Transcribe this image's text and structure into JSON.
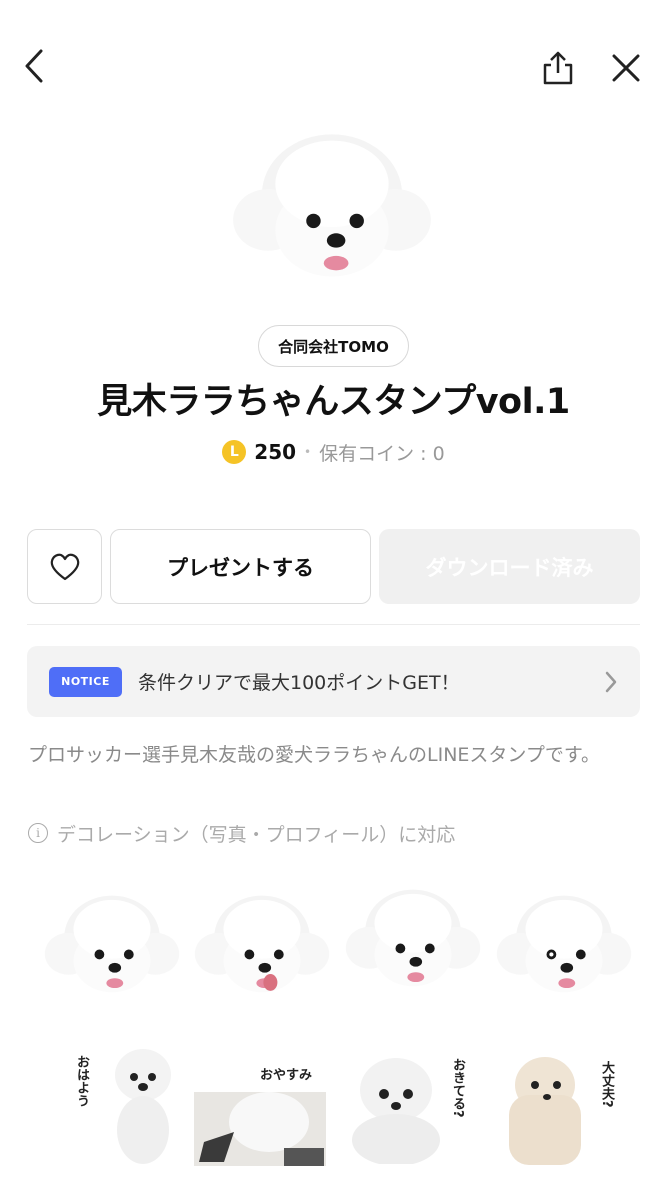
{
  "header": {
    "back_icon": "chevron-left-icon",
    "share_icon": "share-icon",
    "close_icon": "close-icon"
  },
  "product": {
    "author": "合同会社TOMO",
    "title": "見木ララちゃんスタンプvol.1",
    "coin_symbol": "L",
    "price": "250",
    "separator": "•",
    "owned_coins": "保有コイン : 0"
  },
  "actions": {
    "like_icon": "heart-icon",
    "gift_label": "プレゼントする",
    "download_label": "ダウンロード済み"
  },
  "notice": {
    "badge": "NOTICE",
    "text": "条件クリアで最大100ポイントGET！",
    "chevron_icon": "chevron-right-icon"
  },
  "description": "プロサッカー選手見木友哉の愛犬ララちゃんのLINEスタンプです。",
  "deco": {
    "info_icon": "i",
    "text": "デコレーション（写真・プロフィール）に対応"
  },
  "stickers": {
    "row2": [
      {
        "caption": "おはよう"
      },
      {
        "caption": "おやすみ"
      },
      {
        "caption": "おきてる?"
      },
      {
        "caption": "大丈夫?"
      }
    ]
  },
  "colors": {
    "accent_coin": "#f5c326",
    "notice_badge": "#4f6ef7",
    "disabled_button": "#f0f0f0"
  }
}
